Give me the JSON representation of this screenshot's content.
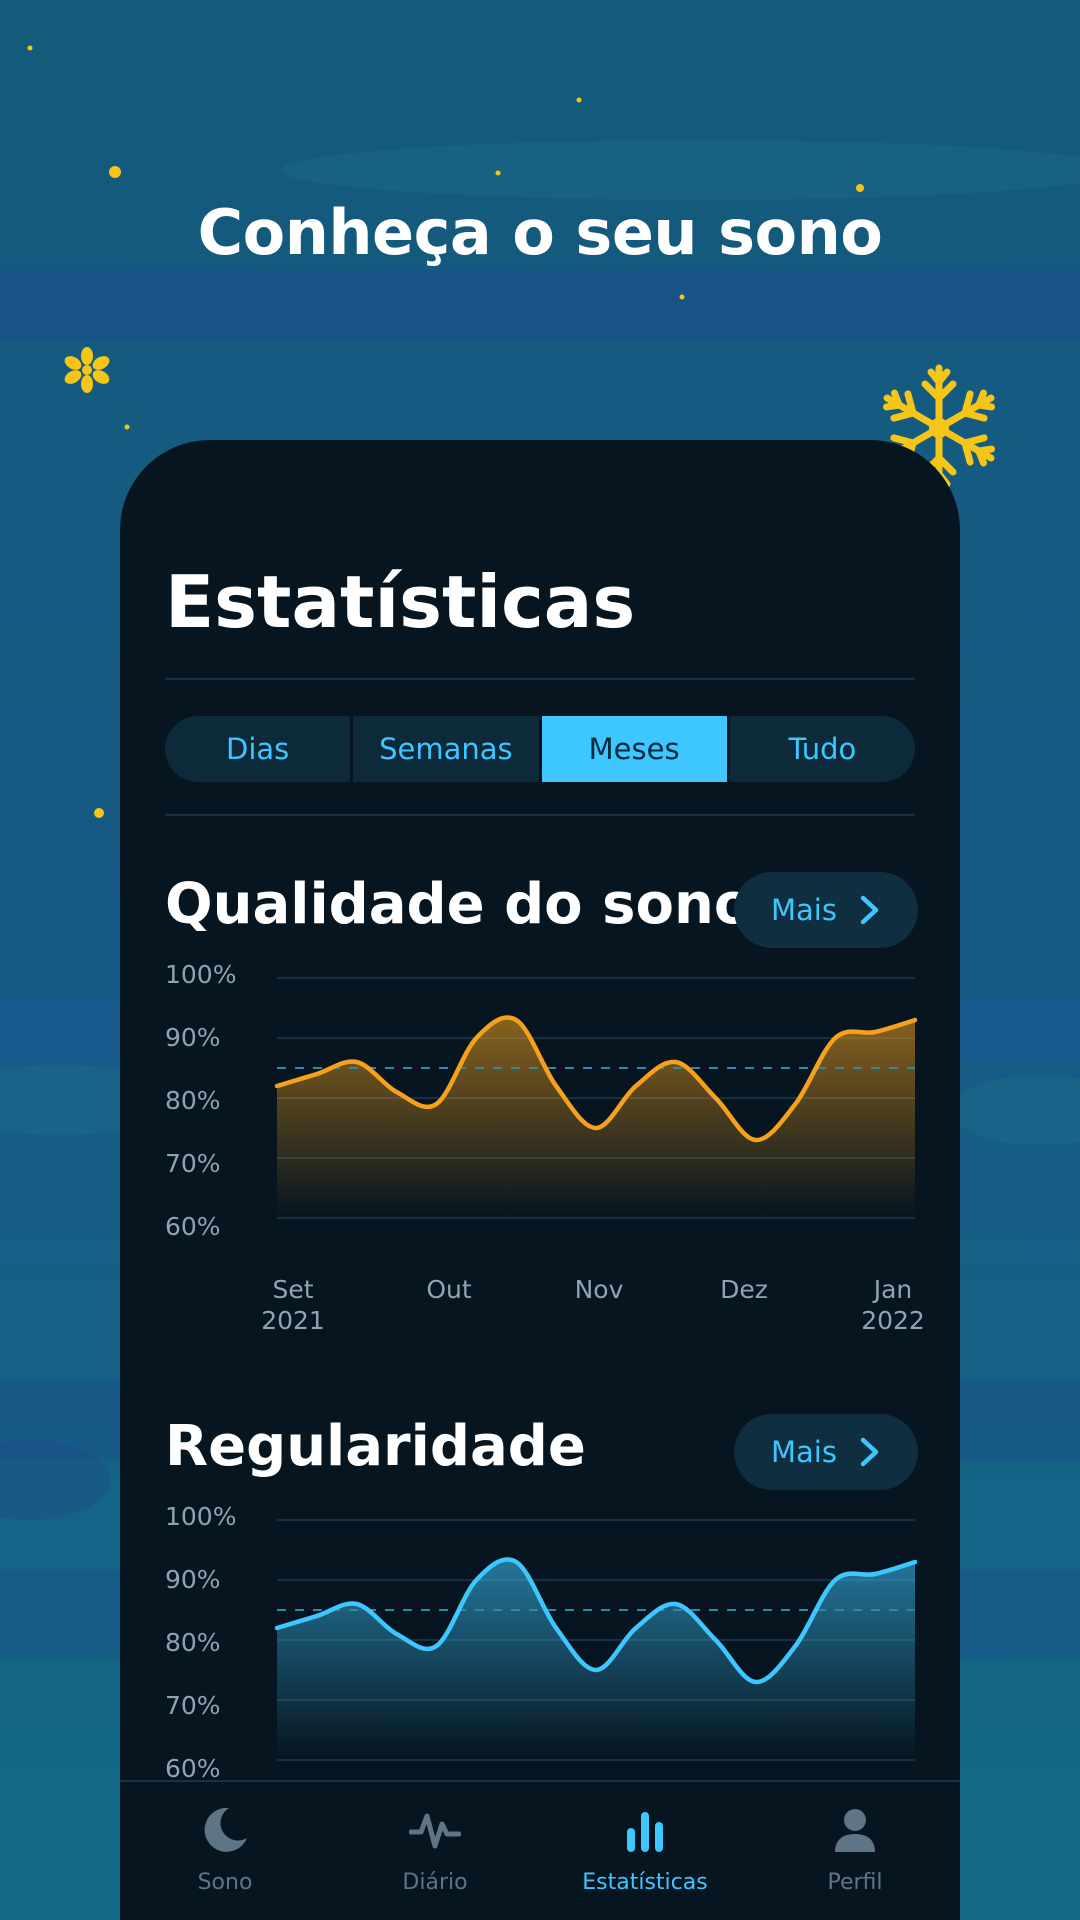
{
  "headline": "Conheça o seu sono",
  "colors": {
    "accent": "#3ec6ff",
    "quality_line": "#f5a11d",
    "regularity_line": "#3ec6ff",
    "star": "#f5c518"
  },
  "screen": {
    "title": "Estatísticas",
    "segments": [
      {
        "label": "Dias",
        "active": false
      },
      {
        "label": "Semanas",
        "active": false
      },
      {
        "label": "Meses",
        "active": true
      },
      {
        "label": "Tudo",
        "active": false
      }
    ]
  },
  "quality": {
    "title": "Qualidade do sono",
    "more_label": "Mais",
    "y_labels": [
      "100%",
      "90%",
      "80%",
      "70%",
      "60%"
    ],
    "x_labels": [
      {
        "month": "Set",
        "year": "2021"
      },
      {
        "month": "Out",
        "year": ""
      },
      {
        "month": "Nov",
        "year": ""
      },
      {
        "month": "Dez",
        "year": ""
      },
      {
        "month": "Jan",
        "year": "2022"
      }
    ]
  },
  "regularity": {
    "title": "Regularidade",
    "more_label": "Mais",
    "y_labels": [
      "100%",
      "90%",
      "80%",
      "70%",
      "60%"
    ]
  },
  "chart_data": [
    {
      "type": "area",
      "title": "Qualidade do sono",
      "ylim": [
        60,
        100
      ],
      "y_ticks": [
        "100%",
        "90%",
        "80%",
        "70%",
        "60%"
      ],
      "x_ticks": [
        "Set 2021",
        "Out",
        "Nov",
        "Dez",
        "Jan 2022"
      ],
      "reference_line": 85,
      "x": [
        0,
        0.5,
        1,
        1.5,
        2,
        2.5,
        3,
        3.5,
        4,
        4.5,
        5,
        5.5,
        6,
        6.5,
        7,
        7.5,
        8
      ],
      "values": [
        82,
        84,
        86,
        81,
        79,
        90,
        93,
        82,
        75,
        82,
        86,
        80,
        73,
        79,
        90,
        91,
        93
      ]
    },
    {
      "type": "area",
      "title": "Regularidade",
      "ylim": [
        60,
        100
      ],
      "y_ticks": [
        "100%",
        "90%",
        "80%",
        "70%",
        "60%"
      ],
      "reference_line": 85,
      "x": [
        0,
        0.5,
        1,
        1.5,
        2,
        2.5,
        3,
        3.5,
        4,
        4.5,
        5,
        5.5,
        6,
        6.5,
        7,
        7.5,
        8
      ],
      "values": [
        82,
        84,
        86,
        81,
        79,
        90,
        93,
        82,
        75,
        82,
        86,
        80,
        73,
        79,
        90,
        91,
        93
      ]
    }
  ],
  "tabbar": [
    {
      "label": "Sono",
      "icon": "moon-icon",
      "active": false
    },
    {
      "label": "Diário",
      "icon": "pulse-icon",
      "active": false
    },
    {
      "label": "Estatísticas",
      "icon": "bar-chart-icon",
      "active": true
    },
    {
      "label": "Perfil",
      "icon": "person-icon",
      "active": false
    }
  ]
}
